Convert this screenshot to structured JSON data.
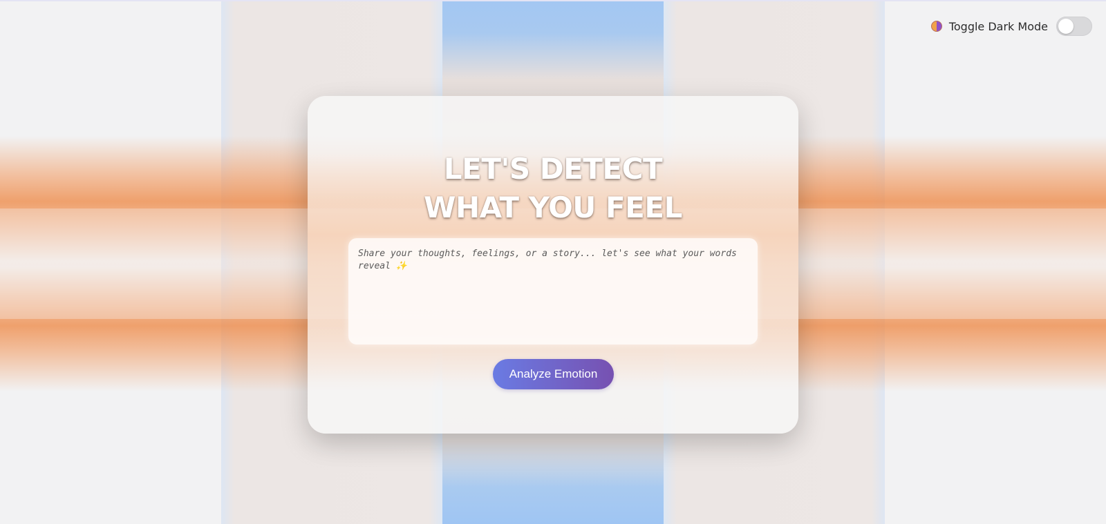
{
  "header": {
    "dark_mode_icon": "half-moon-icon",
    "dark_mode_label": "Toggle Dark Mode",
    "dark_mode_enabled": false
  },
  "card": {
    "title_line_1": "LET'S DETECT",
    "title_line_2": "WHAT YOU FEEL",
    "input_placeholder": "Share your thoughts, feelings, or a story... let's see what your words reveal ✨",
    "input_value": "",
    "analyze_label": "Analyze Emotion"
  },
  "colors": {
    "button_gradient_start": "#6a7be3",
    "button_gradient_end": "#7751b1",
    "accent_orange": "#f0965a",
    "accent_blue": "#a3c7f2"
  }
}
